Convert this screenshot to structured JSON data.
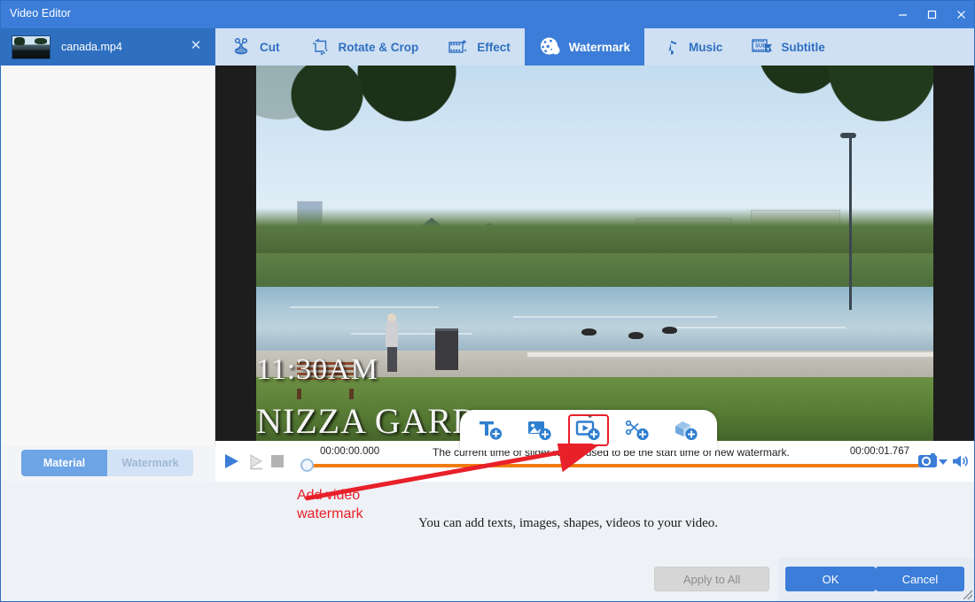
{
  "window": {
    "title": "Video Editor",
    "minimize_label": "minimize",
    "maximize_label": "maximize",
    "close_label": "close"
  },
  "file_tab": {
    "name": "canada.mp4",
    "close_label": "✕"
  },
  "tabs": [
    {
      "label": "Cut",
      "icon": "scissors-icon",
      "active": false
    },
    {
      "label": "Rotate & Crop",
      "icon": "rotate-crop-icon",
      "active": false
    },
    {
      "label": "Effect",
      "icon": "effect-icon",
      "active": false
    },
    {
      "label": "Watermark",
      "icon": "watermark-icon",
      "active": true
    },
    {
      "label": "Music",
      "icon": "music-note-icon",
      "active": false
    },
    {
      "label": "Subtitle",
      "icon": "subtitle-icon",
      "active": false
    }
  ],
  "left_panel": {
    "tabs": [
      {
        "label": "Material",
        "active": true
      },
      {
        "label": "Watermark",
        "active": false
      }
    ]
  },
  "video": {
    "overlay_line1": "11:30AM",
    "overlay_line2": "NIZZA GARD"
  },
  "watermark_toolbar": {
    "collapse_label": "⌄",
    "buttons": [
      {
        "name": "add-text-watermark",
        "label": "Add text watermark",
        "selected": false
      },
      {
        "name": "add-image-watermark",
        "label": "Add image watermark",
        "selected": false
      },
      {
        "name": "add-video-watermark",
        "label": "Add video watermark",
        "selected": true
      },
      {
        "name": "add-shape-watermark",
        "label": "Add shape watermark",
        "selected": false
      },
      {
        "name": "add-3d-watermark",
        "label": "Add 3D shape watermark",
        "selected": false
      }
    ]
  },
  "player": {
    "current_time": "00:00:00.000",
    "total_time": "00:00:01.767",
    "hint": "The current time of slider will be used to be the start time of new watermark.",
    "play_label": "Play",
    "step_label": "Step",
    "stop_label": "Stop",
    "snapshot_label": "Snapshot",
    "volume_label": "Volume",
    "progress_percent": 0
  },
  "bottom": {
    "description": "You can add texts, images, shapes, videos to your video.",
    "apply_to_all": "Apply to All",
    "ok": "OK",
    "cancel": "Cancel"
  },
  "annotation": {
    "text": "Add video\nwatermark",
    "color": "#e8202a"
  },
  "colors": {
    "title_bar": "#3b7dd8",
    "tab_strip": "#cfe0f3",
    "accent": "#2f6fc0",
    "active_tab": "#3b7dd8",
    "progress": "#f07c10",
    "annotation": "#e8202a",
    "panel_bg": "#eef1f5"
  }
}
